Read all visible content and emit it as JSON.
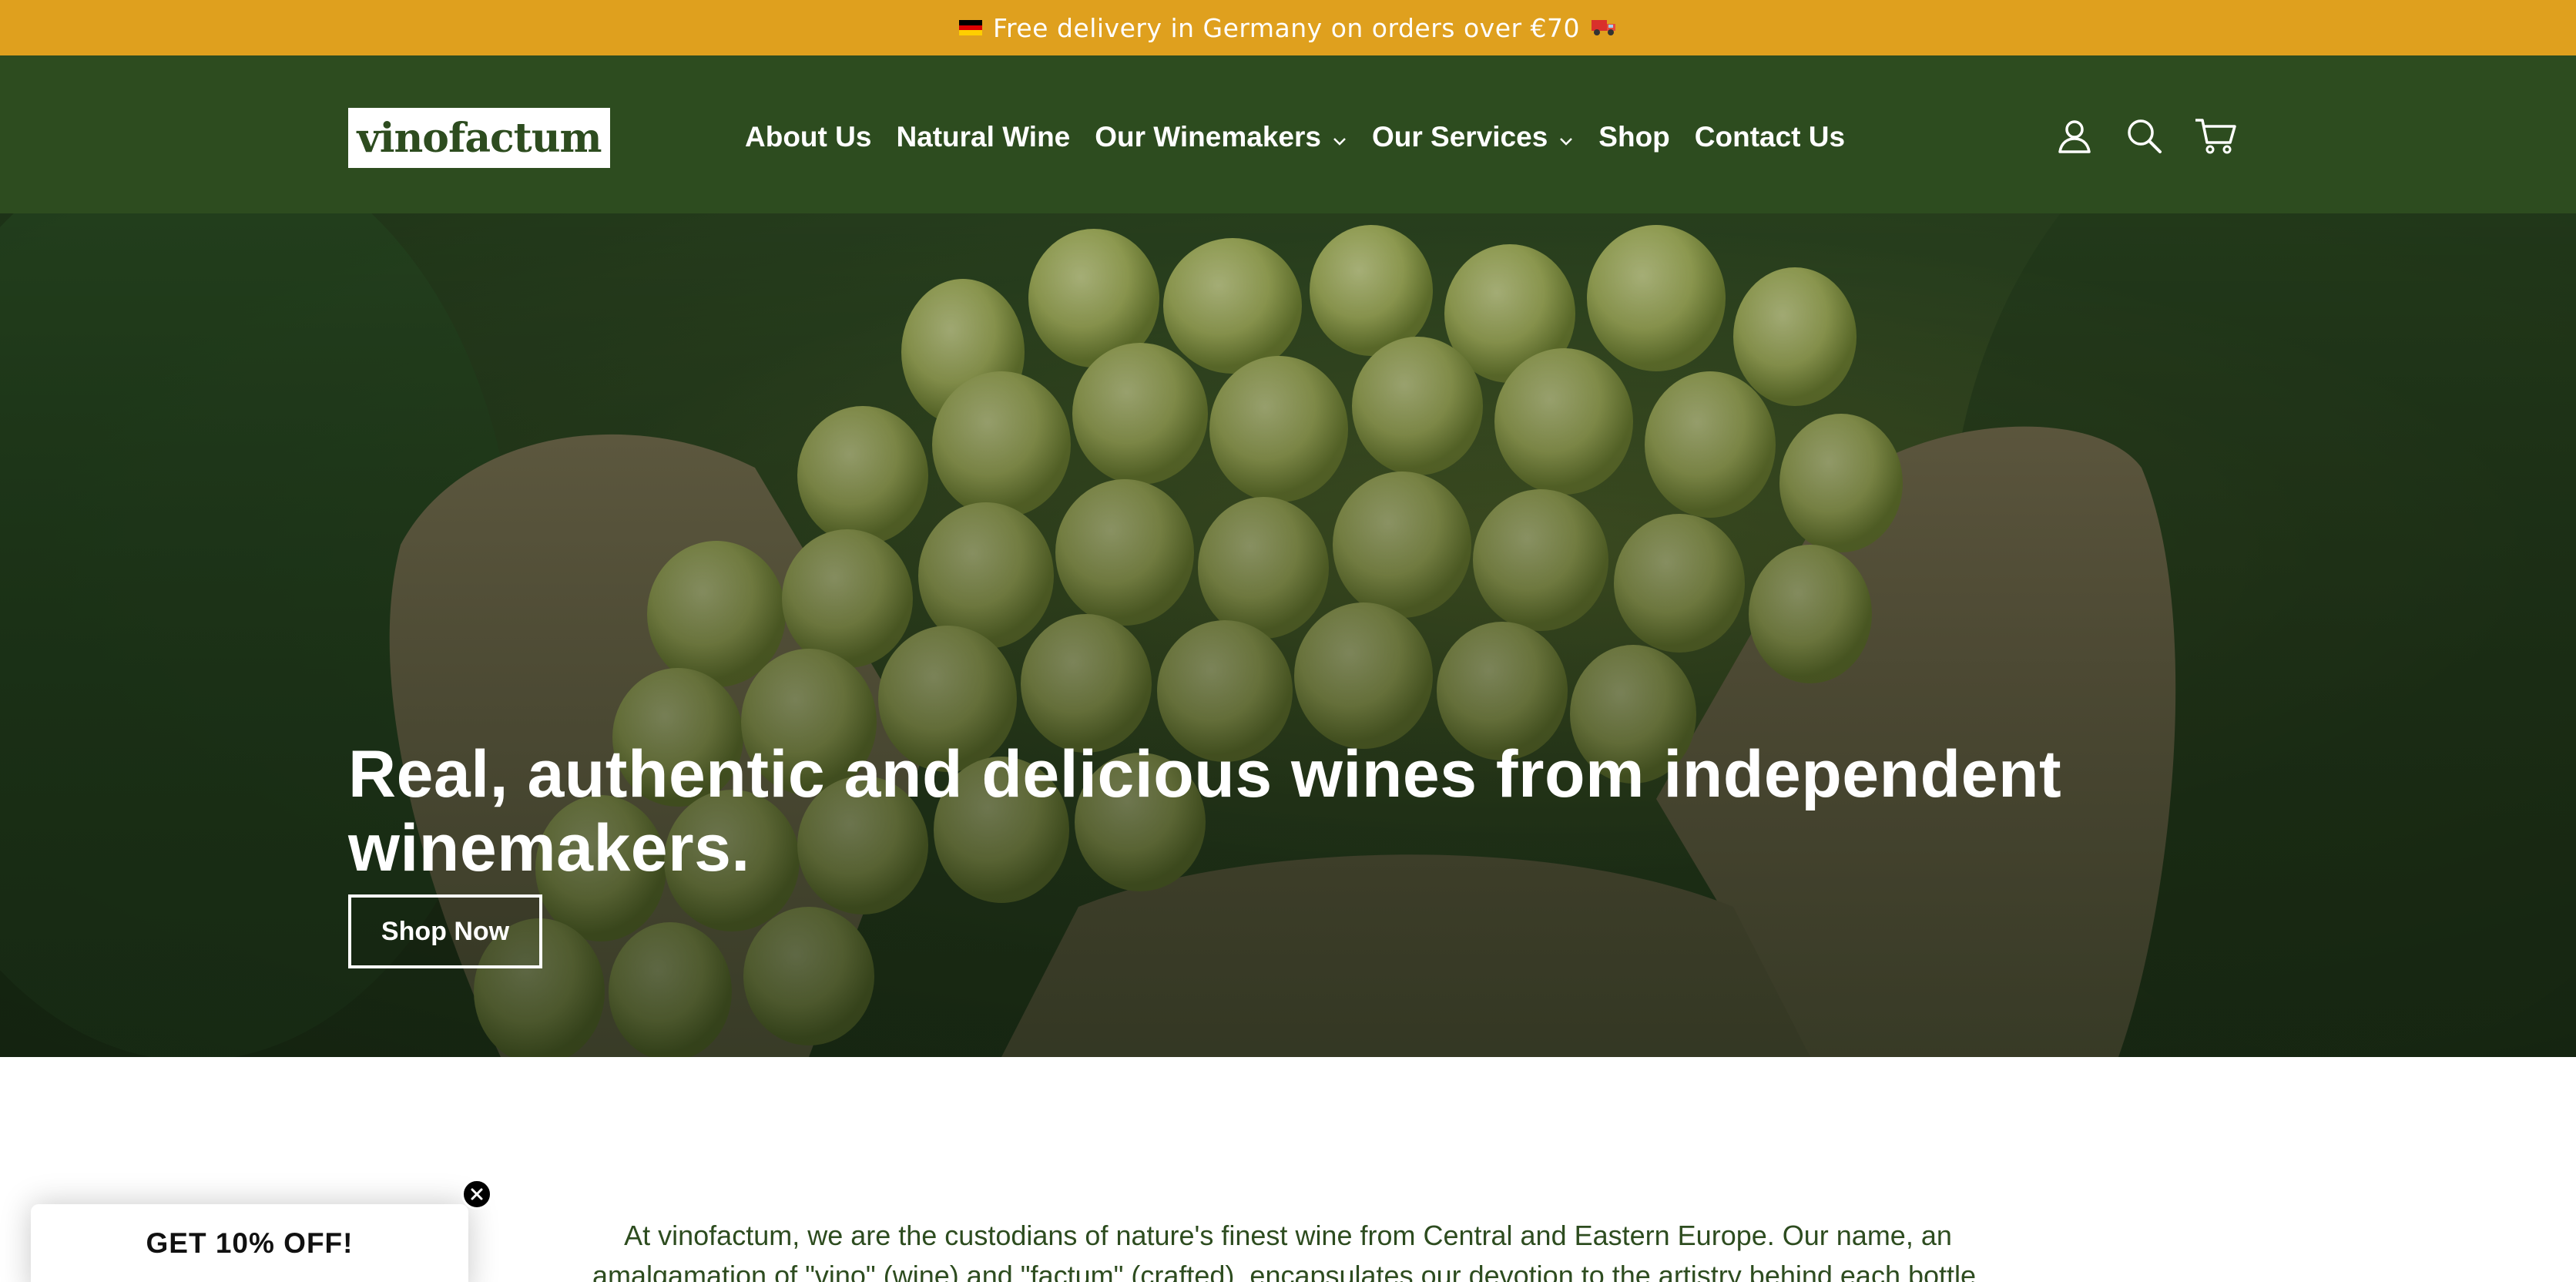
{
  "announcement": {
    "text": "Free delivery in Germany on orders over €70",
    "flag_icon": "germany-flag-icon",
    "truck_icon": "delivery-truck-icon",
    "background": "#dfa01e"
  },
  "header": {
    "logo_text": "vinofactum",
    "background": "#2d4c1f",
    "nav": [
      {
        "label": "About Us",
        "has_dropdown": false
      },
      {
        "label": "Natural Wine",
        "has_dropdown": false
      },
      {
        "label": "Our Winemakers",
        "has_dropdown": true
      },
      {
        "label": "Our Services",
        "has_dropdown": true
      },
      {
        "label": "Shop",
        "has_dropdown": false
      },
      {
        "label": "Contact Us",
        "has_dropdown": false
      }
    ],
    "icons": [
      "account-icon",
      "search-icon",
      "cart-icon"
    ]
  },
  "hero": {
    "title": "Real, authentic and delicious wines from independent winemakers.",
    "button_label": "Shop Now"
  },
  "intro": {
    "line1": "At vinofactum, we are the custodians of nature's finest wine from Central and Eastern Europe. Our name, an",
    "line2": "amalgamation of \"vino\" (wine) and \"factum\" (crafted), encapsulates our devotion to the artistry behind each bottle."
  },
  "popup": {
    "title": "GET 10% OFF!",
    "close_icon": "close-icon"
  }
}
